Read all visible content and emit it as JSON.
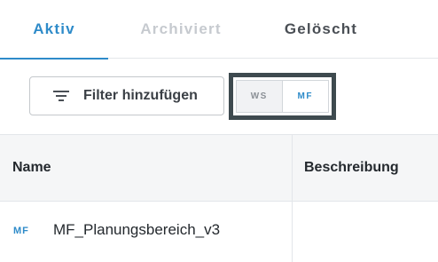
{
  "tabs": [
    {
      "label": "Aktiv",
      "active": true
    },
    {
      "label": "Archiviert",
      "active": false
    },
    {
      "label": "Gelöscht",
      "active": false
    }
  ],
  "toolbar": {
    "filter_label": "Filter hinzufügen",
    "filter_icon": "filter-lines-icon",
    "mode_toggle": [
      {
        "label": "WS",
        "selected": false
      },
      {
        "label": "MF",
        "selected": true
      }
    ]
  },
  "table": {
    "columns": [
      "Name",
      "Beschreibung"
    ],
    "rows": [
      {
        "type_badge": "MF",
        "name": "MF_Planungsbereich_v3",
        "description": ""
      }
    ]
  },
  "colors": {
    "accent": "#2e8bc9",
    "frame": "#3e4a4f",
    "header_bg": "#f5f6f7"
  }
}
